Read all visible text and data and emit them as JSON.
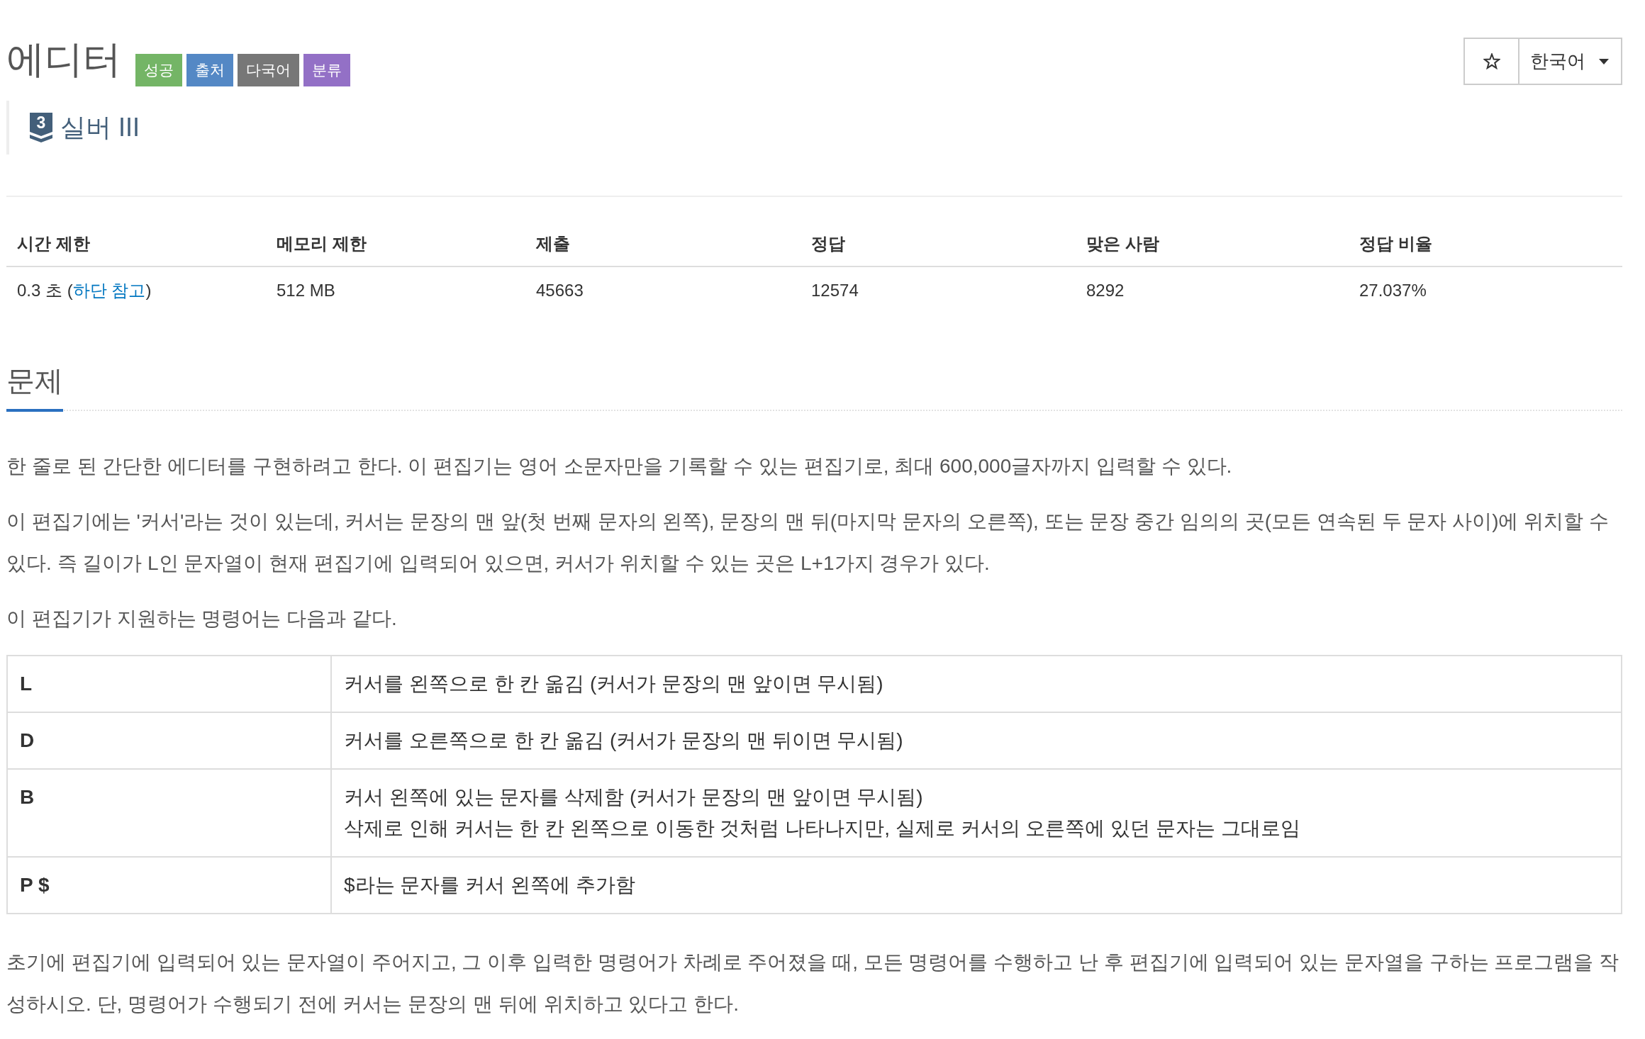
{
  "title": "에디터",
  "labels": [
    {
      "text": "성공",
      "color": "#74b566"
    },
    {
      "text": "출처",
      "color": "#5488c5"
    },
    {
      "text": "다국어",
      "color": "#777777"
    },
    {
      "text": "분류",
      "color": "#9370c6"
    }
  ],
  "tier": {
    "badge": "3",
    "name": "실버 III"
  },
  "language_menu": {
    "value": "한국어"
  },
  "stats": {
    "columns": [
      "시간 제한",
      "메모리 제한",
      "제출",
      "정답",
      "맞은 사람",
      "정답 비율"
    ],
    "row": [
      {
        "text": "0.3 초 (",
        "link": "하단 참고",
        "after": ")"
      },
      {
        "text": "512 MB"
      },
      {
        "text": "45663"
      },
      {
        "text": "12574"
      },
      {
        "text": "8292"
      },
      {
        "text": "27.037%"
      }
    ]
  },
  "problem": {
    "heading": "문제",
    "intro": [
      "한 줄로 된 간단한 에디터를 구현하려고 한다. 이 편집기는 영어 소문자만을 기록할 수 있는 편집기로, 최대 600,000글자까지 입력할 수 있다.",
      "이 편집기에는 '커서'라는 것이 있는데, 커서는 문장의 맨 앞(첫 번째 문자의 왼쪽), 문장의 맨 뒤(마지막 문자의 오른쪽), 또는 문장 중간 임의의 곳(모든 연속된 두 문자 사이)에 위치할 수 있다. 즉 길이가 L인 문자열이 현재 편집기에 입력되어 있으면, 커서가 위치할 수 있는 곳은 L+1가지 경우가 있다.",
      "이 편집기가 지원하는 명령어는 다음과 같다."
    ],
    "commands": [
      {
        "key": "L",
        "description": [
          "커서를 왼쪽으로 한 칸 옮김 (커서가 문장의 맨 앞이면 무시됨)"
        ]
      },
      {
        "key": "D",
        "description": [
          "커서를 오른쪽으로 한 칸 옮김 (커서가 문장의 맨 뒤이면 무시됨)"
        ]
      },
      {
        "key": "B",
        "description": [
          "커서 왼쪽에 있는 문자를 삭제함 (커서가 문장의 맨 앞이면 무시됨)",
          "삭제로 인해 커서는 한 칸 왼쪽으로 이동한 것처럼 나타나지만, 실제로 커서의 오른쪽에 있던 문자는 그대로임"
        ]
      },
      {
        "key": "P $",
        "description": [
          "$라는 문자를 커서 왼쪽에 추가함"
        ]
      }
    ],
    "outro": [
      "초기에 편집기에 입력되어 있는 문자열이 주어지고, 그 이후 입력한 명령어가 차례로 주어졌을 때, 모든 명령어를 수행하고 난 후 편집기에 입력되어 있는 문자열을 구하는 프로그램을 작성하시오. 단, 명령어가 수행되기 전에 커서는 문장의 맨 뒤에 위치하고 있다고 한다."
    ]
  }
}
